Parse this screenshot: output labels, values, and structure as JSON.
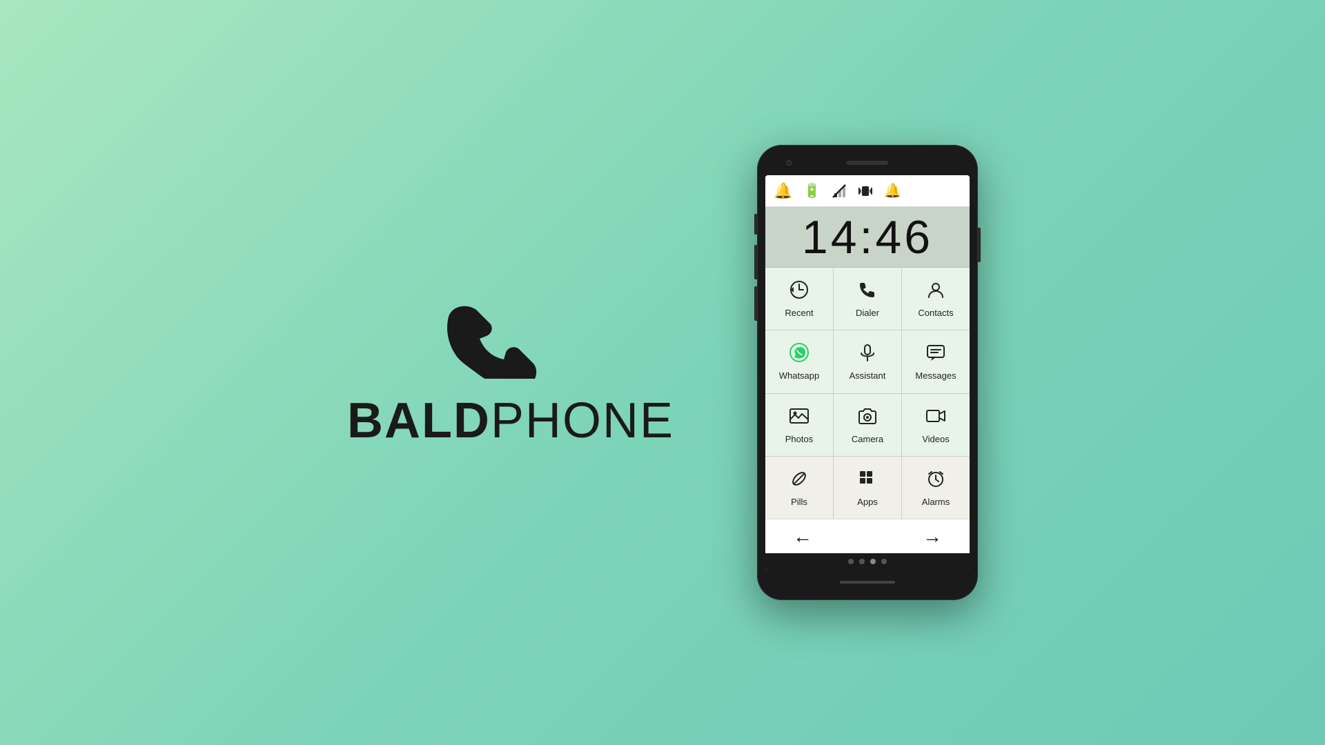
{
  "background": "#7dd4b8",
  "logo": {
    "bold_text": "BALD",
    "regular_text": "PHONE"
  },
  "phone": {
    "time": "14:46",
    "status_icons": [
      "🔔",
      "🔋",
      "📵",
      "📳",
      "🔔"
    ],
    "app_rows": [
      [
        {
          "label": "Recent",
          "icon": "🕐",
          "style": "green"
        },
        {
          "label": "Dialer",
          "icon": "📞",
          "style": "green"
        },
        {
          "label": "Contacts",
          "icon": "👤",
          "style": "green"
        }
      ],
      [
        {
          "label": "Whatsapp",
          "icon": "💬",
          "style": "green",
          "is_whatsapp": true
        },
        {
          "label": "Assistant",
          "icon": "🎤",
          "style": "green"
        },
        {
          "label": "Messages",
          "icon": "💬",
          "style": "green"
        }
      ],
      [
        {
          "label": "Photos",
          "icon": "🖼️",
          "style": "green"
        },
        {
          "label": "Camera",
          "icon": "📷",
          "style": "green"
        },
        {
          "label": "Videos",
          "icon": "🎬",
          "style": "green"
        }
      ],
      [
        {
          "label": "Pills",
          "icon": "💊",
          "style": "light"
        },
        {
          "label": "Apps",
          "icon": "⊞",
          "style": "light"
        },
        {
          "label": "Alarms",
          "icon": "⏰",
          "style": "light"
        }
      ]
    ],
    "nav": {
      "back": "←",
      "forward": "→"
    },
    "dots": [
      false,
      false,
      true,
      false
    ]
  }
}
